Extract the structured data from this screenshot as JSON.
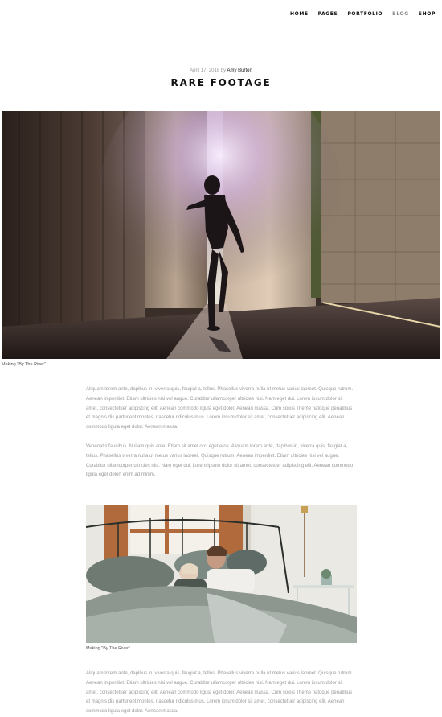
{
  "nav": {
    "items": [
      {
        "label": "HOME"
      },
      {
        "label": "PAGES"
      },
      {
        "label": "PORTFOLIO"
      },
      {
        "label": "BLOG"
      },
      {
        "label": "SHOP"
      }
    ]
  },
  "post": {
    "date": "April 17, 2018",
    "by": "by",
    "author": "Amy Burton",
    "title": "RARE FOOTAGE",
    "hero_caption": "Making \"By The River\"",
    "paragraph1": "Aliquam lorem ante, dapibus in, viverra quis, feugiat a, tellus. Phasellus viverra nulla ut metus varius laoreet. Quisque rutrum. Aenean imperdiet. Etiam ultricies nisi vel augue. Curabitur ullamcorper ultricies nisi. Nam eget dui. Lorem ipsum dolor sit amet, consectetuer adipiscing elit. Aenean commodo ligula eget dolor. Aenean massa. Cum sociis Theme natoque penatibus et magnis dis parturient montes, nascetur ridiculus mus. Lorem ipsum dolor sit amet, consectetuer adipiscing elit. Aenean commodo ligula eget dolor. Aenean massa.",
    "paragraph2": "Venenatis faucibus. Nullam quis ante. Etiam sit amet orci eget eros. Aliquam lorem ante, dapibus in, viverra quis, feugiat a, tellus. Phasellus viverra nulla ut metus varius laoreet. Quisque rutrum. Aenean imperdiet. Etiam ultricies nisi vel augue. Curabitur ullamcorper ultricies nisi. Nam eget dui. Lorem ipsum dolor sit amet, consectetuer adipiscing elit. Aenean commodo ligula eget dolort enim ad minim.",
    "photo2_caption": "Making \"By The River\"",
    "paragraph3": "Aliquam lorem ante, dapibus in, viverra quis, feugiat a, tellus. Phasellus viverra nulla ut metus varius laoreet. Quisque rutrum. Aenean imperdiet. Etiam ultricies nisi vel augue. Curabitur ullamcorper ultricies nisi. Nam eget dui. Lorem ipsum dolor sit amet, consectetuer adipiscing elit. Aenean commodo ligula eget dolor. Aenean massa. Cum sociis Theme natoque penatibus et magnis dis parturient montes, nascetur ridiculus mus. Lorem ipsum dolor sit amet, consectetuer adipiscing elit. Aenean commodo ligula eget dolor. Aenean massa."
  },
  "colors": {
    "text": "#111111",
    "muted": "#9a9a9a",
    "nav_active": "#8a8a8a"
  }
}
